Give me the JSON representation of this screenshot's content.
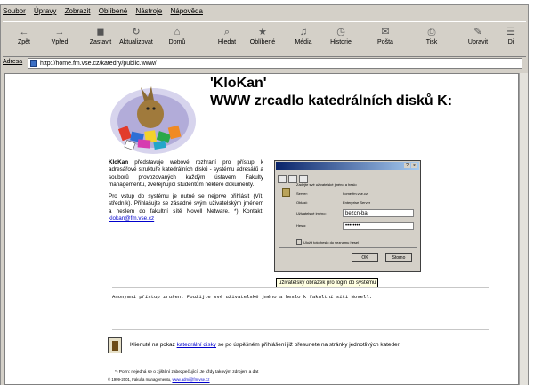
{
  "menu": [
    "Soubor",
    "Úpravy",
    "Zobrazit",
    "Oblíbené",
    "Nástroje",
    "Nápověda"
  ],
  "toolbar": [
    {
      "label": "Zpět",
      "icon": "back-arrow-icon"
    },
    {
      "label": "Vpřed",
      "icon": "forward-arrow-icon"
    },
    {
      "label": "Zastavit",
      "icon": "stop-icon"
    },
    {
      "label": "Aktualizovat",
      "icon": "refresh-icon"
    },
    {
      "label": "Domů",
      "icon": "home-icon"
    },
    {
      "label": "Hledat",
      "icon": "search-icon"
    },
    {
      "label": "Oblíbené",
      "icon": "favorites-icon"
    },
    {
      "label": "Média",
      "icon": "media-icon"
    },
    {
      "label": "Historie",
      "icon": "history-icon"
    },
    {
      "label": "Pošta",
      "icon": "mail-icon"
    },
    {
      "label": "Tisk",
      "icon": "print-icon"
    },
    {
      "label": "Upravit",
      "icon": "edit-icon"
    },
    {
      "label": "Di",
      "icon": "discuss-icon"
    }
  ],
  "address": {
    "label": "Adresa",
    "url": "http://home.fm.vse.cz/katedry/public.www/"
  },
  "page": {
    "title1": "'KloKan'",
    "title2": "WWW zrcadlo katedrálních disků K:",
    "intro_lead": "KloKan",
    "intro_text": " představuje webové rozhraní pro přístup k adresářové struktuře katedrálních disků - systému adresářů a souborů provozovaných každým ústavem Fakulty managementu, zveřejňující studentům některé dokumenty.",
    "access_text": "Pro vstup do systému je nutné se nejprve přihlásit (Vít, středník). Přihlašujte se zásadně svým uživatelským jménem a heslem do fakultní sítě Novell Netware. *) Kontakt:",
    "contact": "klokan@fm.vse.cz",
    "caption": "uživatelský obrázek pro login do systému",
    "anon_text": "Anonymní přístup zrušen. Použijte své uživatelské jméno a heslo k fakultní síti Novell.",
    "nav_text_before": "Klienuté na pokaz",
    "nav_link": "katedrální disky",
    "nav_text_after": "se po úspěšném přihlášení již přesunete na stránky jednotlivých kateder.",
    "footnote": "*) Pozn: nejedná se o zjištění zabezpečující: Je vždy takovým zdrojem a dat",
    "copyright": "© 1999-2001, Fakulta managementu,",
    "copyright_link": "www.admi@fm.vse.cz"
  },
  "dialog": {
    "header": "Zadejte své uživatelské jméno a heslo",
    "server_label": "Server:",
    "server_value": "home.fm.vse.cz",
    "realm_label": "Oblast:",
    "realm_value": "Enterprise Server",
    "user_label": "Uživatelské jméno:",
    "user_value": "bezcn-ba",
    "pass_label": "Heslo:",
    "pass_value": "••••••••",
    "save_checkbox": "Uložit toto heslo do seznamu hesel",
    "ok": "OK",
    "cancel": "Storno"
  }
}
